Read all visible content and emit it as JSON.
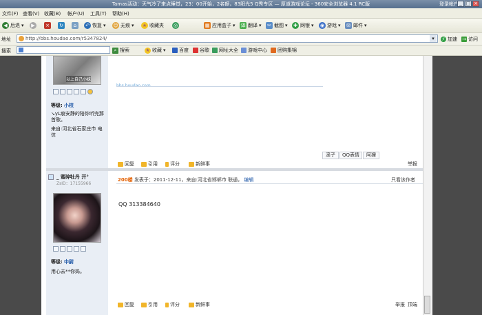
{
  "window": {
    "title": "Tamas活动：天气冷了来点睡觉，23：00开始，2名额，83阳光5 Q秀专区 — 厚道游戏论坛 - 360安全浏览器 4.1 RC版",
    "account_label": "登录帐户",
    "controls": [
      "_",
      "□",
      "×"
    ]
  },
  "menu": [
    "文件(F)",
    "查看(V)",
    "收藏(B)",
    "帐户(U)",
    "工具(T)",
    "帮助(H)"
  ],
  "toolbar": {
    "back": "后退",
    "restore": "恢复",
    "nohistory": "无痕",
    "favorites": "收藏夹",
    "appbox": "应用盒子",
    "translate": "翻译",
    "screenshot": "截图",
    "netbank": "网银",
    "games": "游戏",
    "mail": "邮件"
  },
  "address": {
    "label": "地址",
    "url": "http://bbs.houdao.com/r5347824/",
    "go": "加速",
    "visit": "访问"
  },
  "searchbar": {
    "label": "搜索",
    "search": "搜索",
    "favorites": "收藏",
    "links": [
      "百度",
      "谷歌",
      "网址大全",
      "游戏中心",
      "团购集锦"
    ]
  },
  "post1": {
    "avatar_caption": "以上自己小妹",
    "level_label": "等级:",
    "level": "小校",
    "signature": "↘yL痕安静的陪你听完那首歌。",
    "location": "来自:河北省石家庄市 电信",
    "watermark": "bbs.houdao.com",
    "tabs": [
      "滚子",
      "QQ表情",
      "阿狸"
    ],
    "actions": [
      "回复",
      "引用",
      "评分",
      "新鲜事"
    ],
    "report": "举报"
  },
  "post2": {
    "username": "_ 蜜碎牡丹 开°",
    "uid": "ZsID：17155966",
    "floor": "200楼",
    "meta": "发表于：2011-12-11，来自:河北省邯郸市 联通，",
    "edit": "编辑",
    "only_author": "只看该作者",
    "content": "QQ  313384640",
    "level_label": "等级:",
    "level": "中尉",
    "signature": "用心去**你妈。",
    "actions": [
      "回复",
      "引用",
      "评分",
      "新鲜事"
    ],
    "report_a": "举报",
    "report_b": "顶端"
  },
  "colors": {
    "titlebar": "#56708f",
    "link": "#1e57a7",
    "floor": "#e35f00",
    "sidebar": "#e9eef5"
  }
}
